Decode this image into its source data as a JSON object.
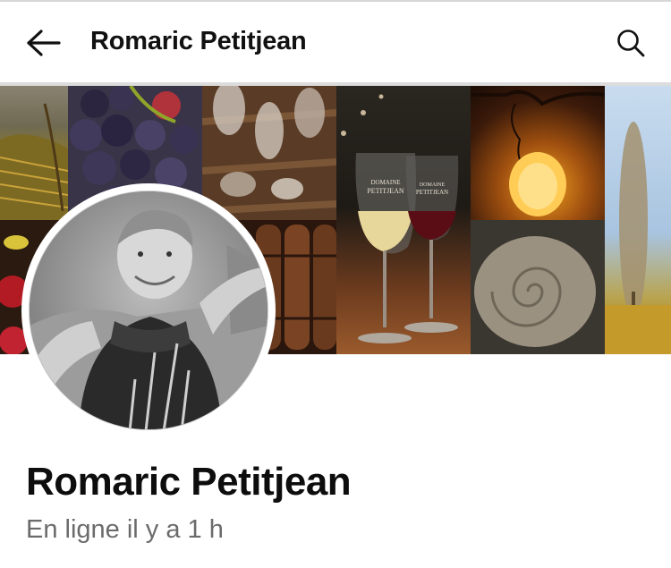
{
  "header": {
    "title": "Romaric Petitjean",
    "back_icon": "arrow-left-icon",
    "search_icon": "search-icon"
  },
  "cover": {
    "glass_brand_line1": "DOMAINE",
    "glass_brand_line2": "PETITJEAN"
  },
  "profile": {
    "name": "Romaric Petitjean",
    "status": "En ligne il y a 1 h"
  },
  "colors": {
    "background": "#ffffff",
    "text": "#0d0d0d",
    "secondary_text": "#6b6b6b"
  }
}
